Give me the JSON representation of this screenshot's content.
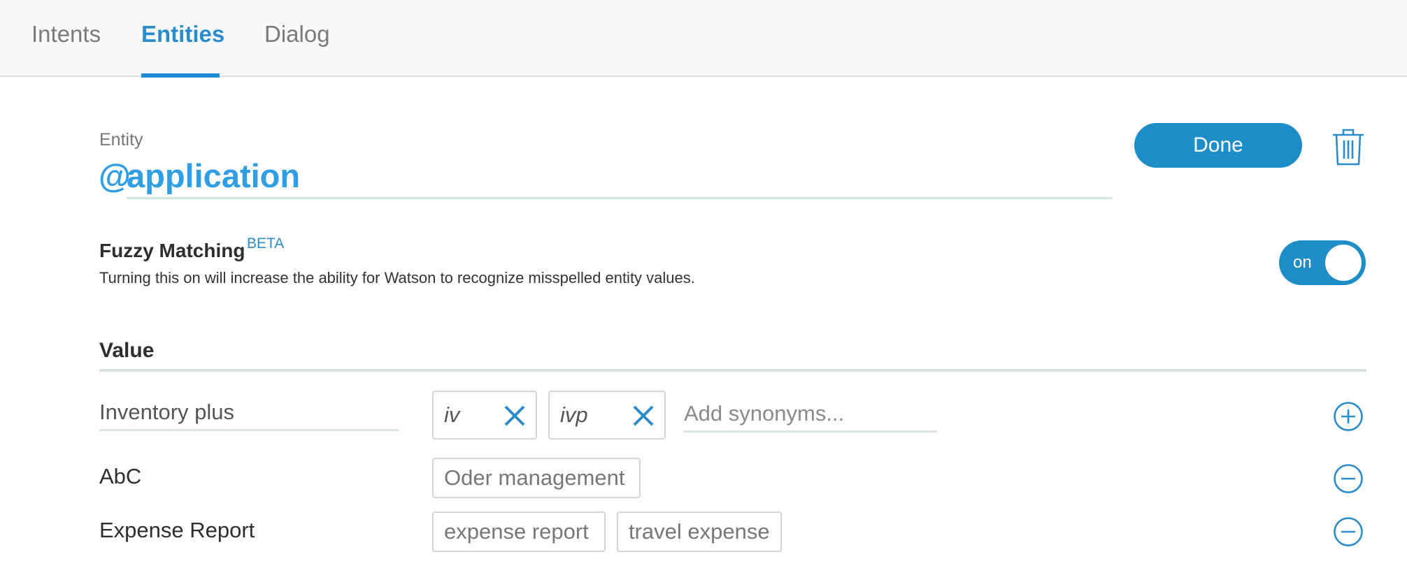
{
  "tabs": [
    "Intents",
    "Entities",
    "Dialog"
  ],
  "entity": {
    "label": "Entity",
    "at": "@",
    "name": "application"
  },
  "done_label": "Done",
  "fuzzy": {
    "title": "Fuzzy Matching",
    "beta": "BETA",
    "description": "Turning this on will increase the ability for Watson to recognize misspelled entity values.",
    "toggle_label": "on"
  },
  "value_heading": "Value",
  "edit_row": {
    "value": "Inventory plus",
    "synonyms": [
      "iv",
      "ivp"
    ],
    "add_placeholder": "Add synonyms..."
  },
  "rows": [
    {
      "value": "AbC",
      "synonyms": [
        "Oder management"
      ]
    },
    {
      "value": "Expense Report",
      "synonyms": [
        "expense report",
        "travel expense"
      ]
    }
  ],
  "colors": {
    "accent": "#1f8dc8",
    "link": "#2f9ee3"
  }
}
